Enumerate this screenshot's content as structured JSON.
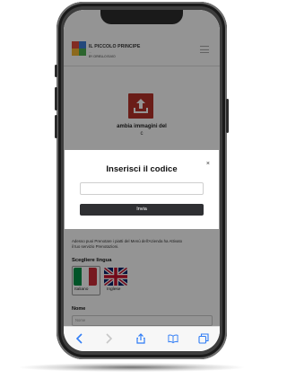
{
  "header": {
    "brand_title": "IL PICCOLO PRINCIPE",
    "brand_subtitle": "...",
    "brand_by": "BY CIRIELLO ELVIO"
  },
  "upload": {
    "label_line1": "ambia immagini del",
    "label_line2": "c"
  },
  "modal": {
    "title": "Inserisci il codice",
    "input_value": "",
    "submit_label": "Invia",
    "close_glyph": "×"
  },
  "info": {
    "line1": "Adesso puoi Prenotare i piatti del Menù dell'Azienda ha Attivato",
    "line2": "il tuo servizio Prenotazioni."
  },
  "language": {
    "title": "Scegliere lingua",
    "options": [
      {
        "label": "Italiano",
        "selected": true
      },
      {
        "label": "Inglese",
        "selected": false
      }
    ]
  },
  "name_field": {
    "label": "Nome",
    "placeholder": "Nome"
  },
  "toolbar_icons": [
    "back-icon",
    "forward-icon",
    "share-icon",
    "bookmarks-icon",
    "tabs-icon"
  ],
  "colors": {
    "accent_red": "#b7322a",
    "button_dark": "#2f3033",
    "toolbar_blue": "#2f7cf6"
  }
}
